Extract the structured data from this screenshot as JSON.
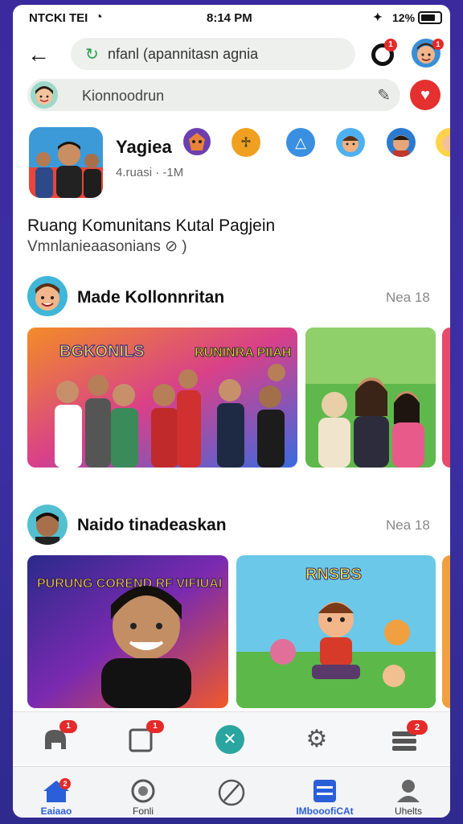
{
  "status_bar": {
    "carrier": "NTCKI TEI",
    "time": "8:14 PM",
    "battery": "12%",
    "icons": [
      "wifi-icon",
      "signal-icon",
      "battery-icon"
    ]
  },
  "header": {
    "back_icon": "back-arrow-icon",
    "search_text": "nfanl (apannitasn agnia",
    "search_icon": "refresh-icon",
    "notif_badge": "1",
    "profile_badge": "1"
  },
  "compose": {
    "placeholder": "Kionnoodrun",
    "edit_icon": "pen-icon",
    "action_icon": "gift-icon"
  },
  "group": {
    "name": "Yagiea",
    "meta": "4.ruasi  ·  -1M"
  },
  "stories": [
    "tiger-avatar",
    "orange-avatar",
    "chart-avatar",
    "boy-avatar",
    "man-avatar",
    "girl-avatar"
  ],
  "community": {
    "title": "Ruang Komunitans Kutal Pagjein",
    "subtitle": "Vmnlanieaasonians  ⊘ )"
  },
  "posts": [
    {
      "author": "Made Kollonnritan",
      "time": "Nea 18",
      "image1_text": "BGKONILS",
      "image1_banner": "RUNINRA PIIAH"
    },
    {
      "author": "Naido tinadeaskan",
      "time": "Nea 18",
      "image1_text": "PURUNG COREND RF VIFIUAI",
      "image2_text": "RNSBS"
    }
  ],
  "tabbar_top": [
    {
      "icon": "elephant-icon",
      "badge": "1"
    },
    {
      "icon": "square-icon",
      "badge": "1"
    },
    {
      "icon": "close-circle-icon",
      "badge": ""
    },
    {
      "icon": "gear-icon",
      "badge": ""
    },
    {
      "icon": "list-icon",
      "badge": "2"
    }
  ],
  "tabbar_bottom": [
    {
      "icon": "home-icon",
      "label": "Eaiaao",
      "badge": "2"
    },
    {
      "icon": "face-icon",
      "label": "Fonli",
      "badge": ""
    },
    {
      "icon": "ban-icon",
      "label": "",
      "badge": ""
    },
    {
      "icon": "menu-icon",
      "label": "IMbooofiCAt",
      "badge": ""
    },
    {
      "icon": "person-icon",
      "label": "Uhelts",
      "badge": ""
    }
  ],
  "colors": {
    "accent": "#2b5fd9",
    "badge_red": "#e52a2a",
    "teal": "#2aa5a0"
  }
}
